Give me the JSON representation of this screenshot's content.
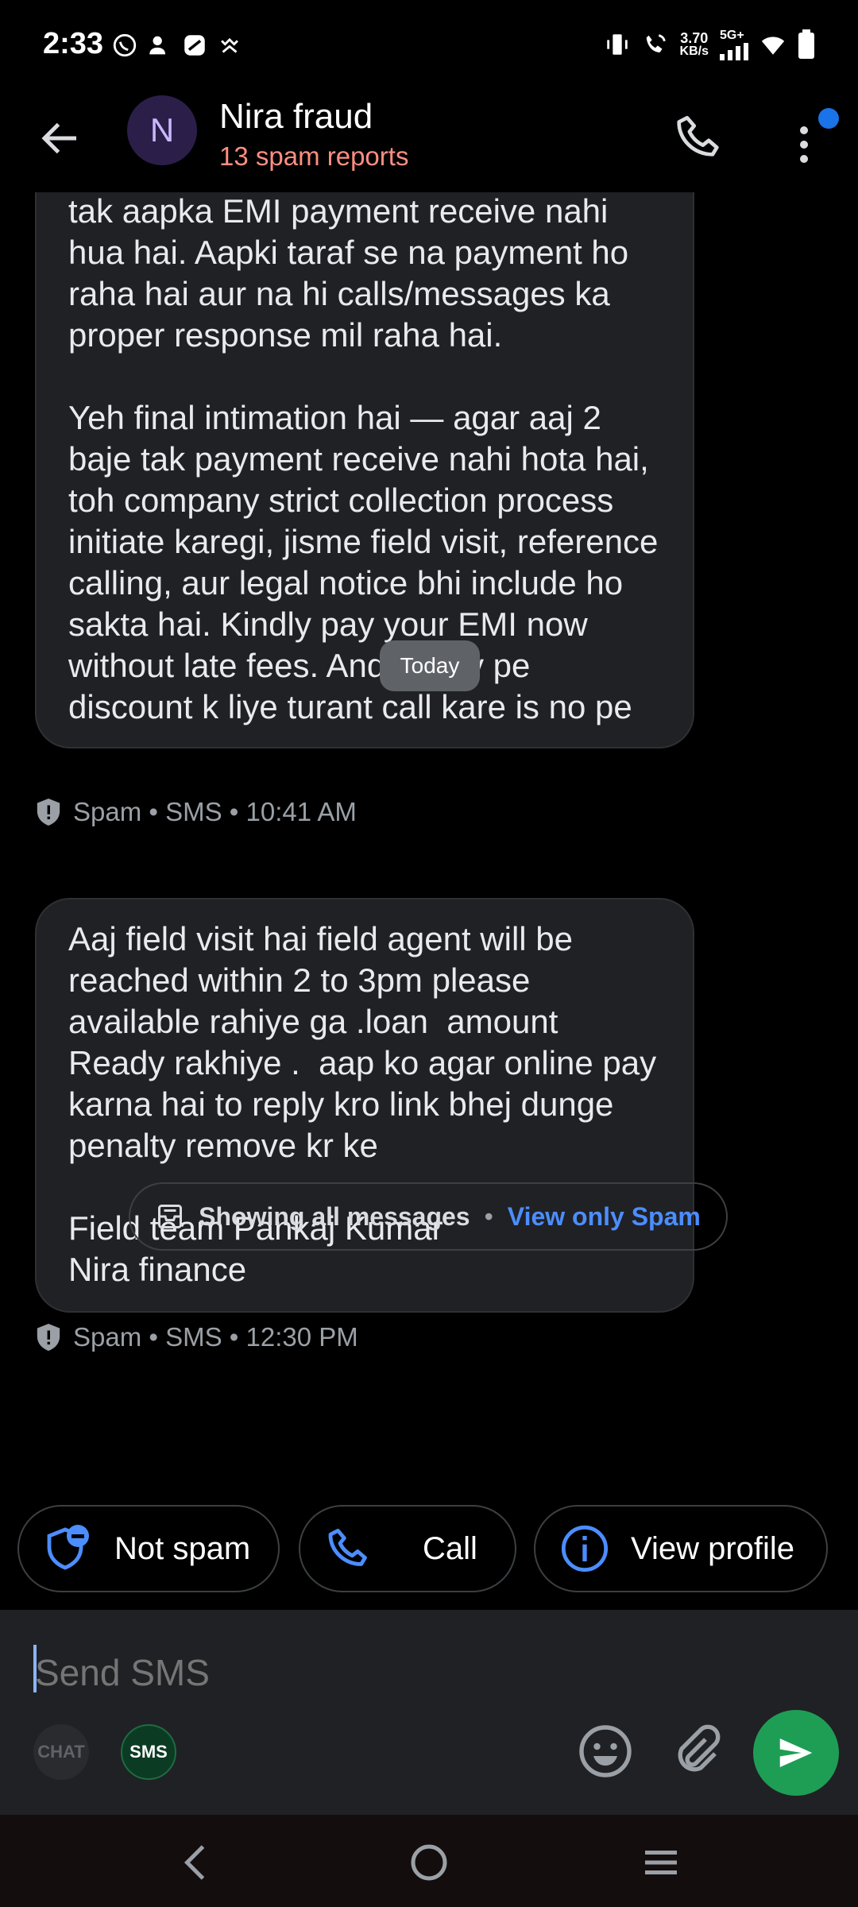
{
  "status_bar": {
    "time": "2:33",
    "net_speed_value": "3.70",
    "net_speed_unit": "KB/s",
    "network_type": "5G+",
    "left_icons": [
      "whatsapp-icon",
      "contact-icon",
      "app-icon",
      "cast-icon"
    ],
    "right_icons": [
      "vibrate-icon",
      "wifi-calling-icon",
      "signal-icon",
      "wifi-icon",
      "battery-icon"
    ]
  },
  "header": {
    "avatar_letter": "N",
    "contact_name": "Nira fraud",
    "subtitle": "13 spam reports",
    "colors": {
      "avatar_bg": "#2b1f4a",
      "spam_text": "#ff8e82",
      "badge": "#1a73e8"
    }
  },
  "messages": [
    {
      "text": "tak aapka EMI payment receive nahi hua hai. Aapki taraf se na payment ho raha hai aur na hi calls/messages ka proper response mil raha hai.\n\nYeh final intimation hai — agar aaj 2 baje tak payment receive nahi hota hai, toh company strict collection process initiate karegi, jisme field visit, reference calling, aur legal notice bhi include ho sakta hai. Kindly pay your EMI now without late fees. And panlty pe discount k liye turant call kare is no pe",
      "meta": "Spam • SMS • 10:41 AM"
    },
    {
      "text": "Aaj field visit hai field agent will be reached within 2 to 3pm please available rahiye ga .loan  amount Ready rakhiye .  aap ko agar online pay karna hai to reply kro link bhej dunge penalty remove kr ke\n\nField team Pankaj Kumar\nNira finance",
      "meta": "Spam • SMS • 12:30 PM"
    }
  ],
  "date_divider": "Today",
  "filter": {
    "label": "Showing all messages",
    "separator": "•",
    "link": "View only Spam"
  },
  "actions": {
    "not_spam": "Not spam",
    "call": "Call",
    "view_profile": "View profile"
  },
  "composer": {
    "placeholder": "Send SMS",
    "mode_chat": "CHAT",
    "mode_sms": "SMS",
    "send_color": "#1e9e55"
  }
}
